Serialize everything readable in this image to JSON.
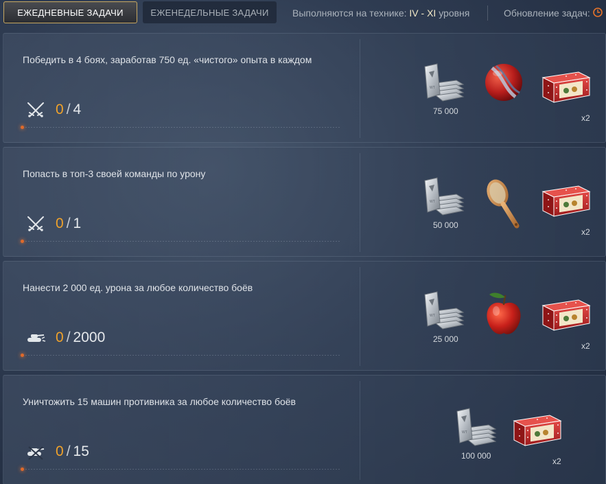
{
  "tabs": {
    "daily": "Ежедневные задачи",
    "weekly": "Еженедельные задачи"
  },
  "tier_info": {
    "prefix": "Выполняются на технике: ",
    "range": "IV - XI",
    "suffix": " уровня"
  },
  "refresh_label": "Обновление задач:",
  "colors": {
    "progress_current": "#f0a22a",
    "active_tab_border": "#c8a860"
  },
  "tasks": [
    {
      "title": "Победить в 4 боях, заработав 750 ед. «чистого» опыта в каждом",
      "icon": "crossed-swords-icon",
      "current": "0",
      "sep": "/",
      "target": "4",
      "rewards": [
        {
          "icon": "silver-bars-icon",
          "label": "75 000"
        },
        {
          "icon": "striped-ball-icon",
          "label": ""
        },
        {
          "icon": "gift-box-icon",
          "label": "x2"
        }
      ]
    },
    {
      "title": "Попасть в топ-3 своей команды по урону",
      "icon": "crossed-swords-icon",
      "current": "0",
      "sep": "/",
      "target": "1",
      "rewards": [
        {
          "icon": "silver-bars-icon",
          "label": "50 000"
        },
        {
          "icon": "bath-brush-icon",
          "label": ""
        },
        {
          "icon": "gift-box-icon",
          "label": "x2"
        }
      ]
    },
    {
      "title": "Нанести 2 000 ед. урона за любое количество боёв",
      "icon": "tank-damage-icon",
      "current": "0",
      "sep": "/",
      "target": "2000",
      "rewards": [
        {
          "icon": "silver-bars-icon",
          "label": "25 000"
        },
        {
          "icon": "apple-icon",
          "label": ""
        },
        {
          "icon": "gift-box-icon",
          "label": "x2"
        }
      ]
    },
    {
      "title": "Уничтожить 15 машин противника за любое количество боёв",
      "icon": "tank-destroyed-icon",
      "current": "0",
      "sep": "/",
      "target": "15",
      "rewards": [
        {
          "icon": "silver-bars-icon",
          "label": "100 000"
        },
        {
          "icon": "gift-box-icon",
          "label": "x2"
        }
      ]
    }
  ]
}
